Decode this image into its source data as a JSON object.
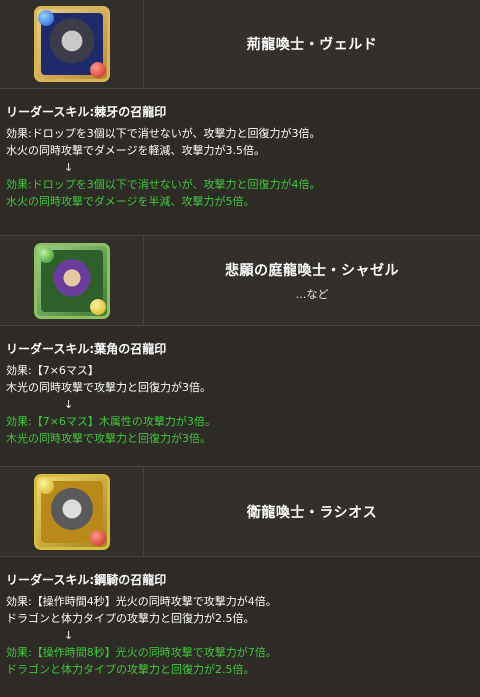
{
  "entries": [
    {
      "name": "荊龍喚士・ヴェルド",
      "note": "",
      "orbs": {
        "top_left": "blue",
        "bottom_right": "red"
      },
      "skill_title": "リーダースキル:棘牙の召龍印",
      "before": [
        "効果:ドロップを3個以下で消せないが、攻撃力と回復力が3倍。",
        "水火の同時攻撃でダメージを軽減、攻撃力が3.5倍。"
      ],
      "arrow": "↓",
      "after": [
        "効果:ドロップを3個以下で消せないが、攻撃力と回復力が4倍。",
        "水火の同時攻撃でダメージを半減、攻撃力が5倍。"
      ]
    },
    {
      "name": "悲願の庭龍喚士・シャゼル",
      "note": "…など",
      "orbs": {
        "top_left": "green",
        "bottom_right": "yellow"
      },
      "skill_title": "リーダースキル:葉角の召龍印",
      "before": [
        "効果:【7×6マス】",
        "木光の同時攻撃で攻撃力と回復力が3倍。"
      ],
      "arrow": "↓",
      "after": [
        "効果:【7×6マス】木属性の攻撃力が3倍。",
        "木光の同時攻撃で攻撃力と回復力が3倍。"
      ]
    },
    {
      "name": "衛龍喚士・ラシオス",
      "note": "",
      "orbs": {
        "top_left": "yellow",
        "bottom_right": "red"
      },
      "skill_title": "リーダースキル:鋼騎の召龍印",
      "before": [
        "効果:【操作時間4秒】光火の同時攻撃で攻撃力が4倍。",
        "ドラゴンと体力タイプの攻撃力と回復力が2.5倍。"
      ],
      "arrow": "↓",
      "after": [
        "効果:【操作時間8秒】光火の同時攻撃で攻撃力が7倍。",
        "ドラゴンと体力タイプの攻撃力と回復力が2.5倍。"
      ]
    }
  ],
  "colors": {
    "background": "#2e2a26",
    "border": "#4a443d",
    "green_text": "#3fc93a"
  }
}
